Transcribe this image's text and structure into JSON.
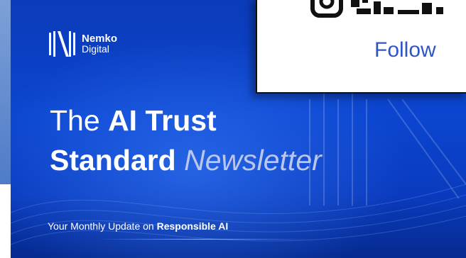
{
  "brand": {
    "name": "Nemko",
    "sub": "Digital"
  },
  "headline": {
    "word1": "The",
    "word2": "AI Trust",
    "word3": "Standard",
    "word4": "Newsletter"
  },
  "tagline": {
    "prefix": "Your Monthly Update on",
    "bold": "Responsible AI"
  },
  "overlay": {
    "follow_label": "Follow"
  },
  "colors": {
    "banner": "#0b45d0",
    "follow": "#2f55c7",
    "accent_text": "#b9c7ec"
  }
}
